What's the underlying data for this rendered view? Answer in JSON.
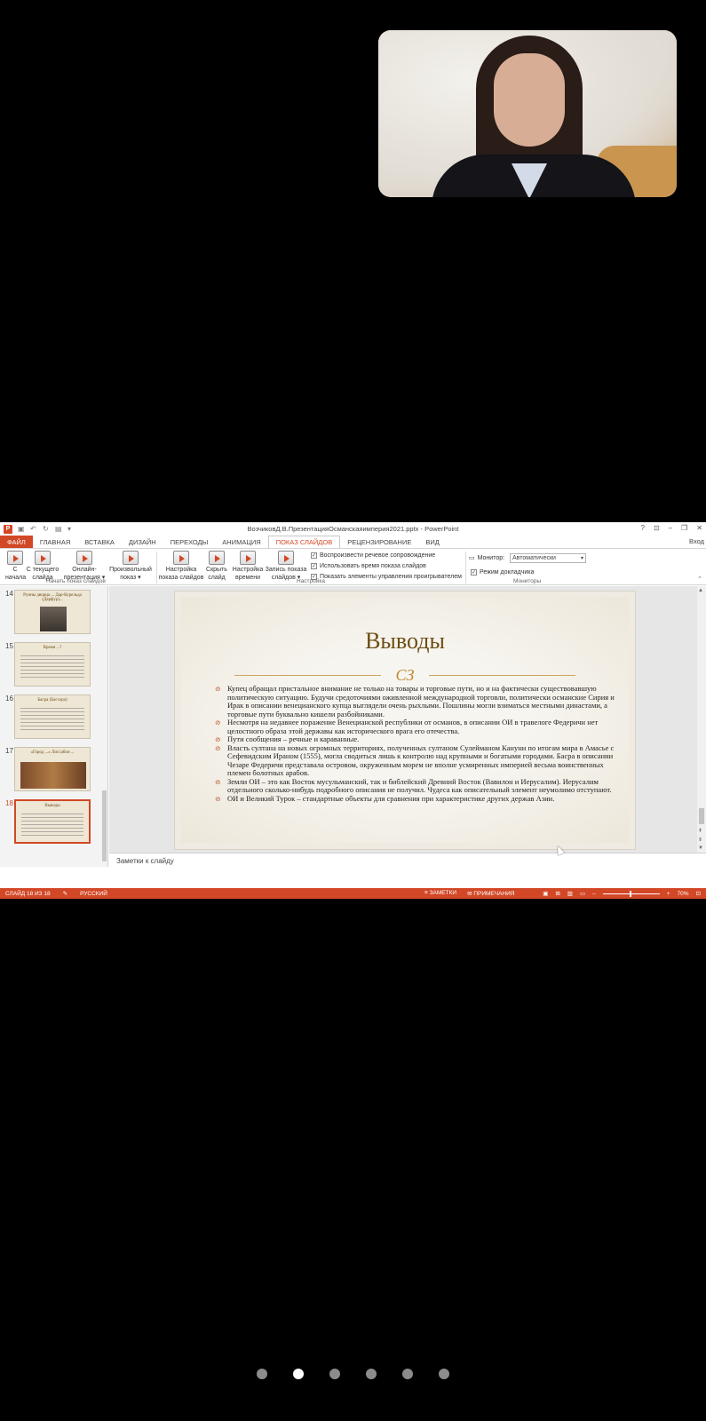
{
  "window": {
    "title": "ВозчиковД.В.ПрезентацияОсманскаяимперия2021.pptx - PowerPoint",
    "controls": [
      "?",
      "⊡",
      "–",
      "❐",
      "✕"
    ],
    "signin": "Вход"
  },
  "tabs": [
    {
      "label": "ФАЙЛ"
    },
    {
      "label": "ГЛАВНАЯ"
    },
    {
      "label": "ВСТАВКА"
    },
    {
      "label": "ДИЗАЙН"
    },
    {
      "label": "ПЕРЕХОДЫ"
    },
    {
      "label": "АНИМАЦИЯ"
    },
    {
      "label": "ПОКАЗ СЛАЙДОВ"
    },
    {
      "label": "РЕЦЕНЗИРОВАНИЕ"
    },
    {
      "label": "ВИД"
    }
  ],
  "ribbon": {
    "start_group": {
      "label": "Начать показ слайдов",
      "buttons": [
        {
          "line1": "С",
          "line2": "начала"
        },
        {
          "line1": "С текущего",
          "line2": "слайда"
        },
        {
          "line1": "Онлайн-",
          "line2": "презентация ▾"
        },
        {
          "line1": "Произвольный",
          "line2": "показ ▾"
        }
      ]
    },
    "setup_group": {
      "label": "Настройка",
      "buttons": [
        {
          "line1": "Настройка",
          "line2": "показа слайдов"
        },
        {
          "line1": "Скрыть",
          "line2": "слайд"
        },
        {
          "line1": "Настройка",
          "line2": "времени"
        },
        {
          "line1": "Запись показа",
          "line2": "слайдов ▾"
        }
      ],
      "checkboxes": [
        {
          "label": "Воспроизвести речевое сопровождение",
          "mark": "✓"
        },
        {
          "label": "Использовать время показа слайдов",
          "mark": "✓"
        },
        {
          "label": "Показать элементы управления проигрывателем",
          "mark": "✓"
        }
      ]
    },
    "monitors_group": {
      "label": "Мониторы",
      "monitor_label": "Монитор:",
      "monitor_value": "Автоматически",
      "presenter_label": "Режим докладчика",
      "presenter_mark": "✓"
    }
  },
  "thumbnails": [
    {
      "num": "14",
      "title": "Руины дворца ... Дар-Курельда (Дарфур)..."
    },
    {
      "num": "15",
      "title": "Время ...?"
    },
    {
      "num": "16",
      "title": "Басра (Бассора)"
    },
    {
      "num": "17",
      "title": "«Город ...» Лиссабон ..."
    },
    {
      "num": "18",
      "title": "Выводы"
    }
  ],
  "slide": {
    "title": "Выводы",
    "ornament": "CЗ",
    "bullets": [
      "Купец обращал пристальное внимание не только на товары и торговые пути, но и на фактически существовавшую политическую ситуацию. Будучи средоточиями оживленной международной торговли, политически османские Сирия и Ирак в описании венецианского купца выглядели очень рыхлыми. Пошлины могли взиматься местными династами, а торговые пути буквально кишели разбойниками.",
      "Несмотря на недавнее поражение Венецианской республики от османов, в описании ОИ в травелоге Федеричи нет целостного образа этой державы как исторического врага его отечества.",
      "Пути сообщения – речные и караванные.",
      "Власть султана на новых огромных территориях, полученных султаном Сулейманом Кануни по итогам мира в Амасье с Сефевидским Ираном (1555), могла сводиться лишь к контролю над крупными и богатыми городами. Басра в описании Чезаре Федеричи представала островом, окруженным морем не вполне усмиренных империей весьма воинственных племен болотных арабов.",
      "Земли ОИ – это как Восток мусульманский, так и библейский Древний Восток (Вавилон и Иерусалим). Иерусалим отдельного сколько-нибудь подробного описания не получил. Чудеса как описательный элемент неумолимо отступают.",
      "ОИ и Великий Турок – стандартные объекты для сравнения при характеристике других держав Азии."
    ]
  },
  "notes_placeholder": "Заметки к слайду",
  "status": {
    "slide_counter": "СЛАЙД 18 ИЗ 18",
    "language": "РУССКИЙ",
    "notes": "ЗАМЕТКИ",
    "comments": "ПРИМЕЧАНИЯ",
    "zoom": "70%"
  },
  "pager": {
    "count": 6,
    "active_index": 1
  }
}
